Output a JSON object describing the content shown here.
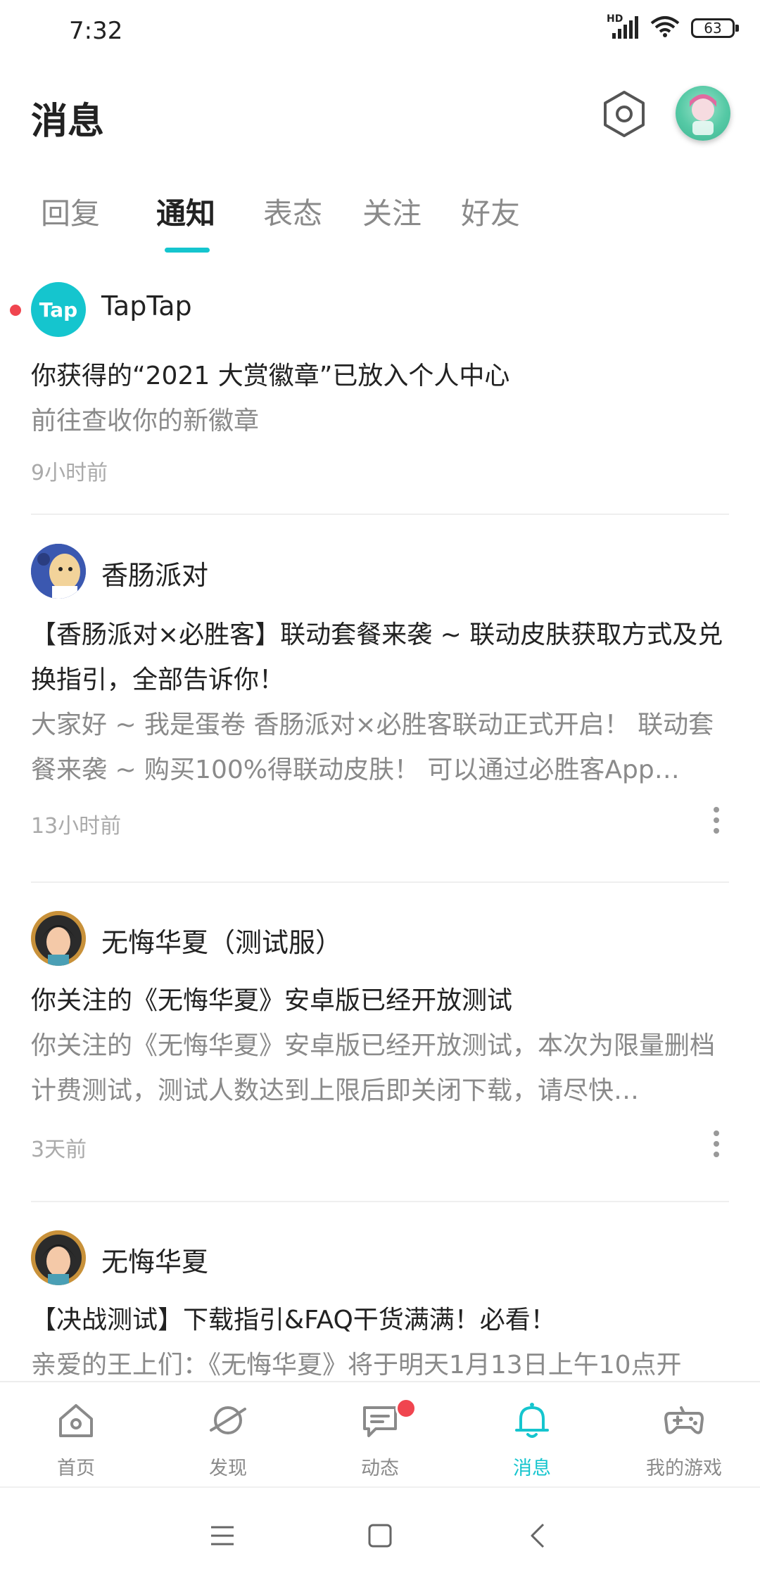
{
  "status_bar": {
    "time": "7:32",
    "network_label": "HD",
    "battery": "63"
  },
  "header": {
    "title": "消息"
  },
  "tabs": [
    {
      "label": "回复",
      "active": false
    },
    {
      "label": "通知",
      "active": true
    },
    {
      "label": "表态",
      "active": false
    },
    {
      "label": "关注",
      "active": false
    },
    {
      "label": "好友",
      "active": false
    }
  ],
  "notifications": [
    {
      "source": "TapTap",
      "avatar_text": "Tap",
      "unread": true,
      "title": "你获得的“2021 大赏徽章”已放入个人中心",
      "body": "前往查收你的新徽章",
      "time": "9小时前"
    },
    {
      "source": "香肠派对",
      "title": "【香肠派对×必胜客】联动套餐来袭 ~ 联动皮肤获取方式及兑换指引，全部告诉你！",
      "body": "大家好 ~ 我是蛋卷 香肠派对×必胜客联动正式开启！ 联动套餐来袭 ~ 购买100%得联动皮肤！ 可以通过必胜客App…",
      "time": "13小时前"
    },
    {
      "source": "无悔华夏（测试服）",
      "title": "你关注的《无悔华夏》安卓版已经开放测试",
      "body": "你关注的《无悔华夏》安卓版已经开放测试，本次为限量删档计费测试，测试人数达到上限后即关闭下载，请尽快…",
      "time": "3天前"
    },
    {
      "source": "无悔华夏",
      "title": "【决战测试】下载指引&FAQ干货满满！必看！",
      "body": "亲爱的王上们：《无悔华夏》将于明天1月13日上午10点开"
    }
  ],
  "bottom_nav": [
    {
      "label": "首页",
      "icon": "home-icon"
    },
    {
      "label": "发现",
      "icon": "planet-icon"
    },
    {
      "label": "动态",
      "icon": "chat-icon",
      "badge": true
    },
    {
      "label": "消息",
      "icon": "bell-icon",
      "active": true
    },
    {
      "label": "我的游戏",
      "icon": "gamepad-icon"
    }
  ],
  "colors": {
    "accent": "#15c5ce",
    "badge": "#f0454f",
    "muted": "#8a8a8a"
  }
}
